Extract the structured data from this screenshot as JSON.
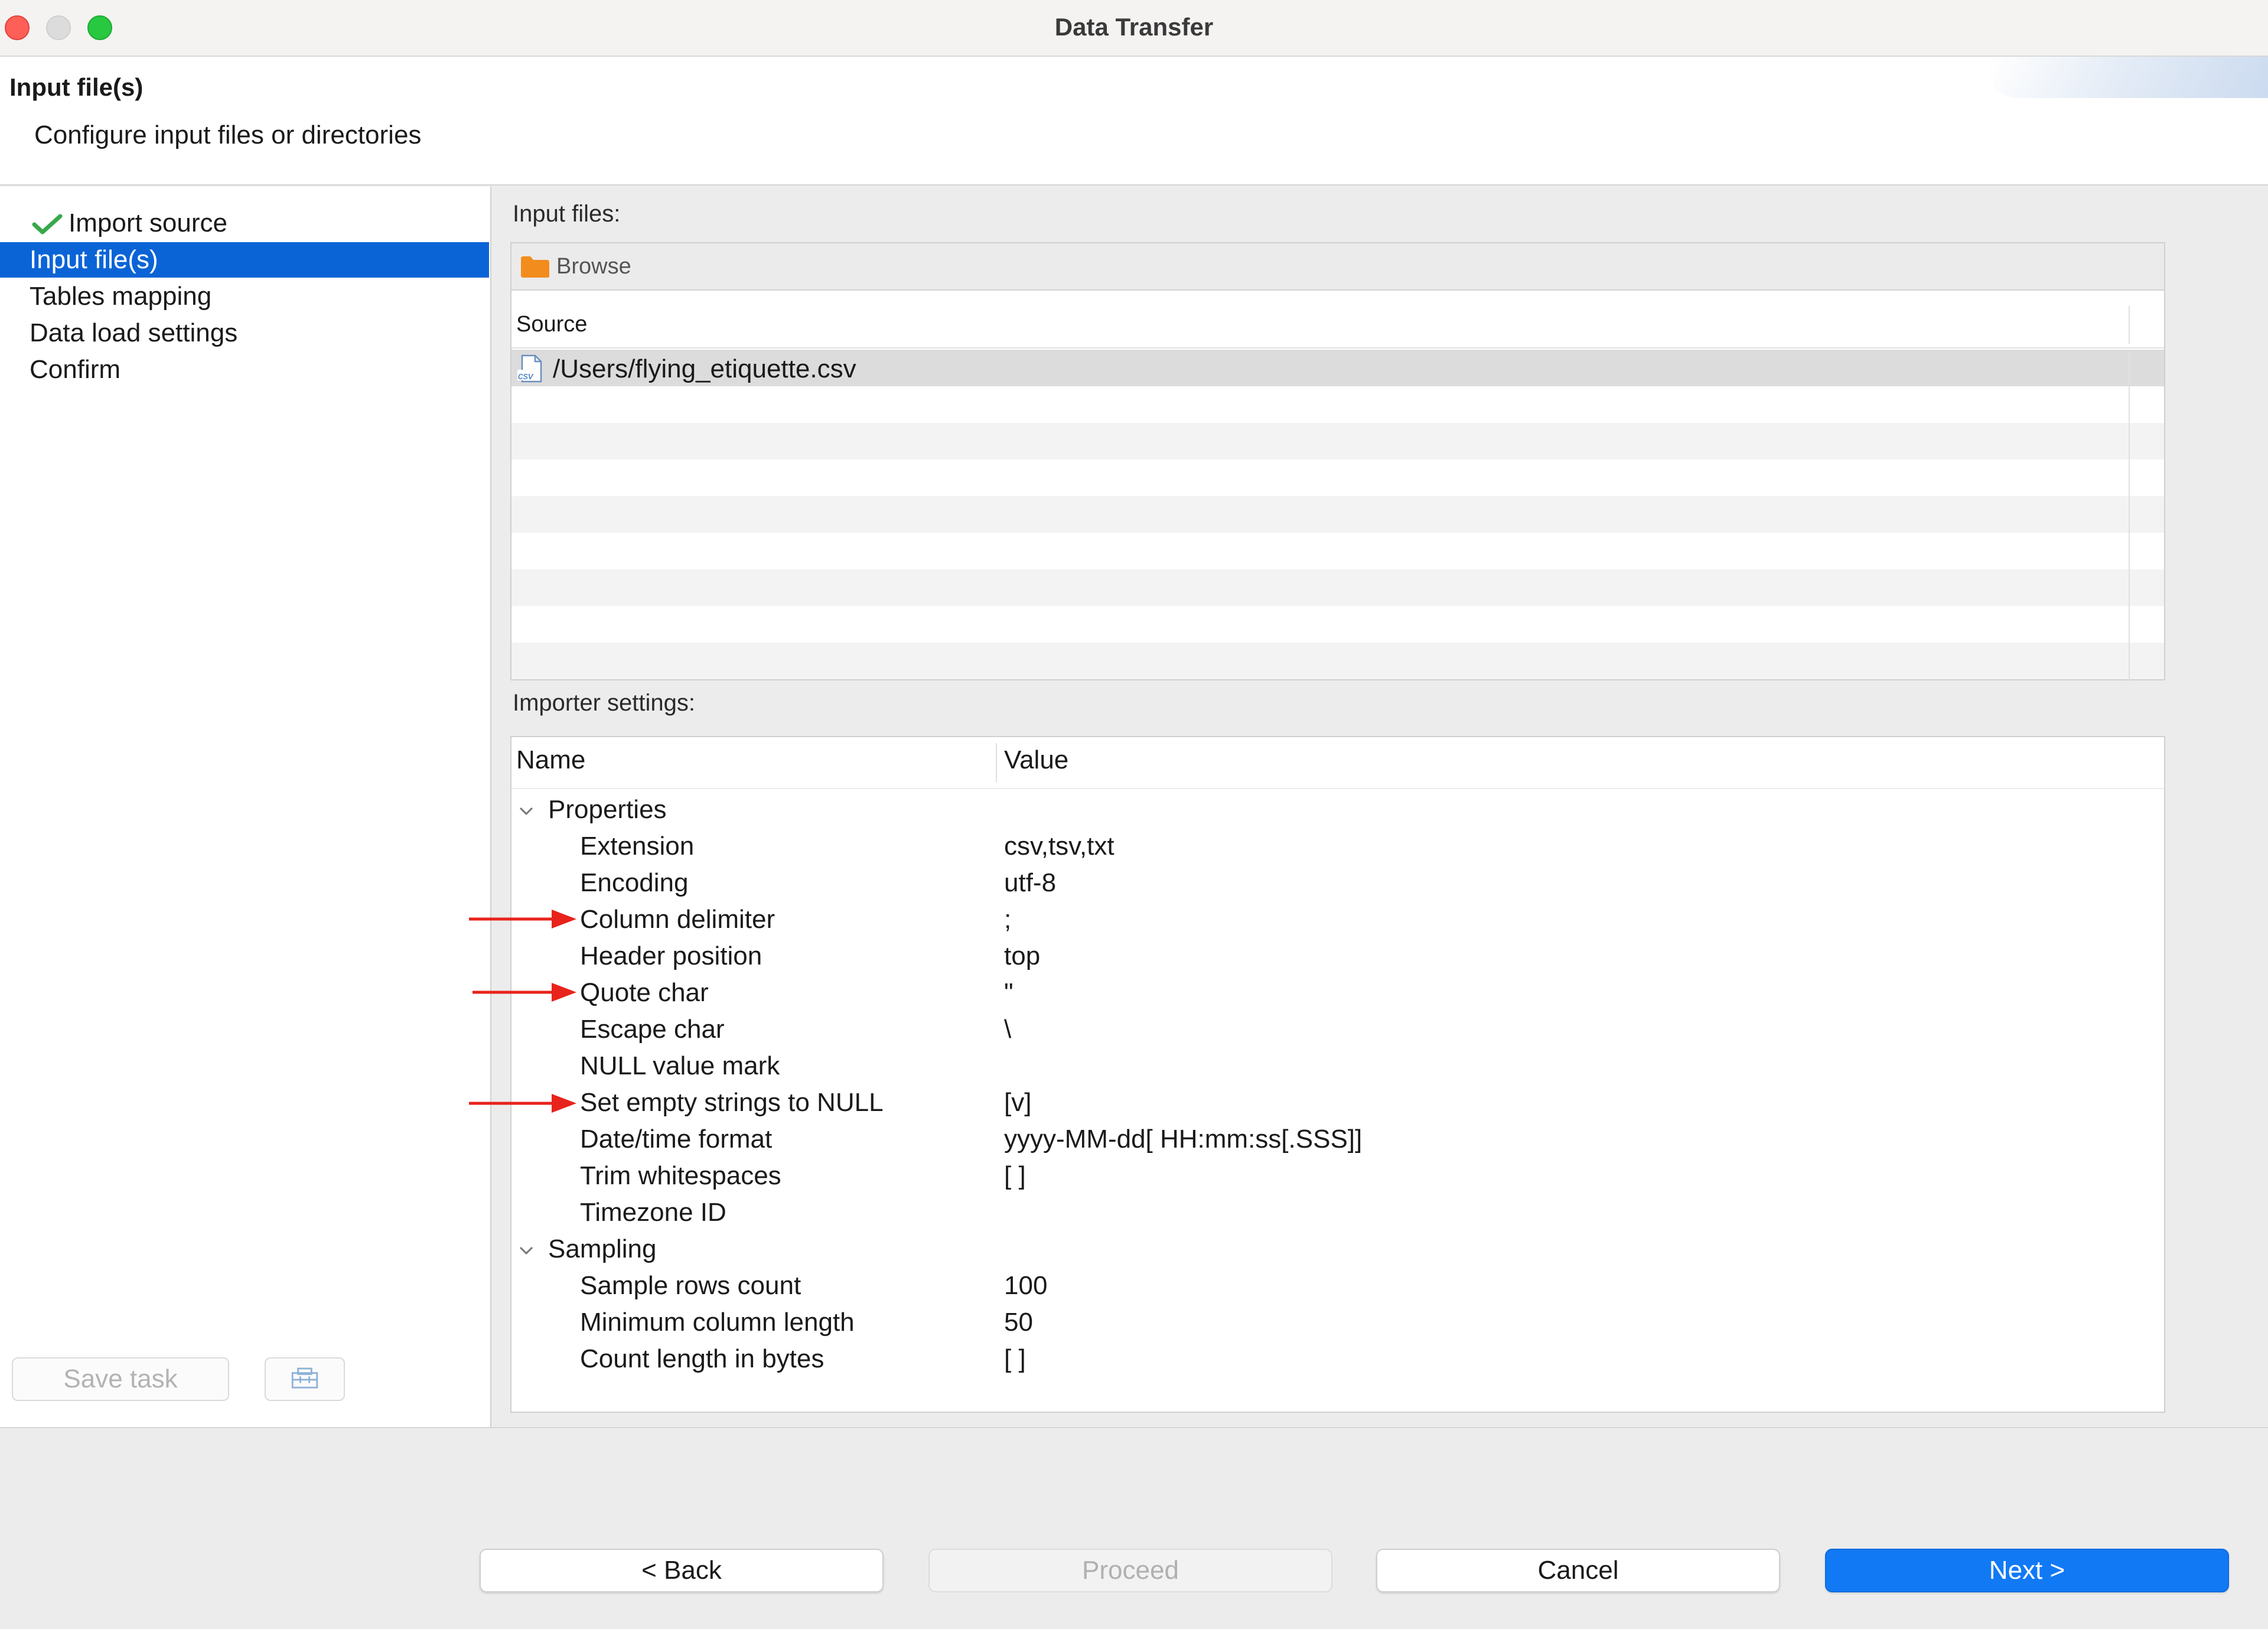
{
  "window": {
    "title": "Data Transfer"
  },
  "header": {
    "title": "Input file(s)",
    "description": "Configure input files or directories"
  },
  "wizard_steps": [
    {
      "label": "Import source",
      "completed": true
    },
    {
      "label": "Input file(s)",
      "selected": true
    },
    {
      "label": "Tables mapping"
    },
    {
      "label": "Data load settings"
    },
    {
      "label": "Confirm"
    }
  ],
  "left_actions": {
    "save_task": "Save task"
  },
  "input_files": {
    "label": "Input files:",
    "browse": "Browse",
    "column_header": "Source",
    "files": [
      "/Users/flying_etiquette.csv"
    ]
  },
  "importer": {
    "label": "Importer settings:",
    "col_name": "Name",
    "col_value": "Value",
    "groups": [
      {
        "name": "Properties",
        "rows": [
          {
            "name": "Extension",
            "value": "csv,tsv,txt"
          },
          {
            "name": "Encoding",
            "value": "utf-8"
          },
          {
            "name": "Column delimiter",
            "value": ";",
            "highlighted": true
          },
          {
            "name": "Header position",
            "value": "top"
          },
          {
            "name": "Quote char",
            "value": "\"",
            "highlighted": true
          },
          {
            "name": "Escape char",
            "value": "\\"
          },
          {
            "name": "NULL value mark",
            "value": ""
          },
          {
            "name": "Set empty strings to NULL",
            "value": "[v]",
            "highlighted": true
          },
          {
            "name": "Date/time format",
            "value": "yyyy-MM-dd[ HH:mm:ss[.SSS]]"
          },
          {
            "name": "Trim whitespaces",
            "value": "[ ]"
          },
          {
            "name": "Timezone ID",
            "value": ""
          }
        ]
      },
      {
        "name": "Sampling",
        "rows": [
          {
            "name": "Sample rows count",
            "value": "100"
          },
          {
            "name": "Minimum column length",
            "value": "50"
          },
          {
            "name": "Count length in bytes",
            "value": "[ ]"
          }
        ]
      }
    ]
  },
  "buttons": {
    "back": "< Back",
    "proceed": "Proceed",
    "cancel": "Cancel",
    "next": "Next >"
  },
  "colors": {
    "selection": "#0a64d6",
    "primary_button": "#1279f5",
    "annotation_arrow": "#e8231b"
  }
}
